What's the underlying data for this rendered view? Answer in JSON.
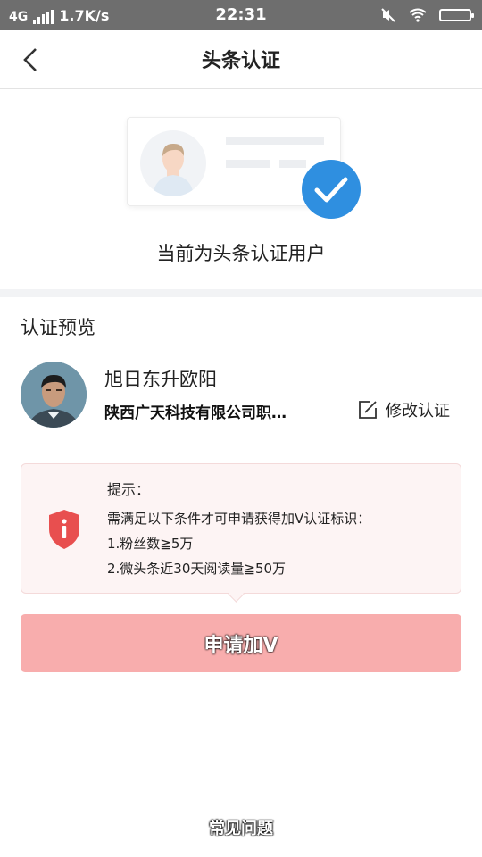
{
  "status_bar": {
    "network": "4G",
    "speed": "1.7K/s",
    "time": "22:31"
  },
  "nav": {
    "title": "头条认证"
  },
  "hero": {
    "status_text": "当前为头条认证用户",
    "check_color": "#2f8fe0"
  },
  "preview": {
    "section_title": "认证预览",
    "user_name": "旭日东升欧阳",
    "company": "陕西广天科技有限公司职…",
    "edit_label": "修改认证"
  },
  "tip": {
    "title": "提示：",
    "lines": [
      "需满足以下条件才可申请获得加V认证标识：",
      "1.粉丝数≧5万",
      "2.微头条近30天阅读量≧50万"
    ],
    "icon": "shield-info-icon",
    "accent_color": "#e84f4f"
  },
  "apply_button": {
    "label": "申请加V",
    "color": "#f8adad"
  },
  "faq": {
    "label": "常见问题"
  }
}
